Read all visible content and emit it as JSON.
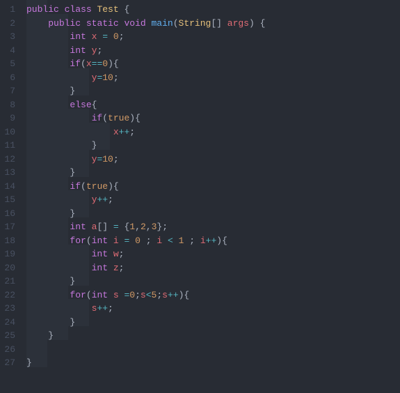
{
  "language": "java",
  "line_count": 27,
  "tokens": {
    "public": "public",
    "class": "class",
    "static": "static",
    "void": "void",
    "int": "int",
    "if": "if",
    "else": "else",
    "for": "for",
    "Test": "Test",
    "main": "main",
    "String": "String",
    "args": "args",
    "x": "x",
    "y": "y",
    "w": "w",
    "z": "z",
    "a": "a",
    "i": "i",
    "s": "s",
    "true": "true",
    "n0": "0",
    "n1": "1",
    "n2": "2",
    "n3": "3",
    "n5": "5",
    "n10": "10"
  },
  "lines": {
    "l1": "1",
    "l2": "2",
    "l3": "3",
    "l4": "4",
    "l5": "5",
    "l6": "6",
    "l7": "7",
    "l8": "8",
    "l9": "9",
    "l10": "10",
    "l11": "11",
    "l12": "12",
    "l13": "13",
    "l14": "14",
    "l15": "15",
    "l16": "16",
    "l17": "17",
    "l18": "18",
    "l19": "19",
    "l20": "20",
    "l21": "21",
    "l22": "22",
    "l23": "23",
    "l24": "24",
    "l25": "25",
    "l26": "26",
    "l27": "27"
  },
  "colors": {
    "background": "#282c34",
    "foreground": "#abb2bf",
    "keyword": "#c678dd",
    "class": "#e5c07b",
    "method": "#61afef",
    "variable": "#e06c75",
    "number": "#d19a66",
    "operator": "#56b6c2",
    "gutter": "#495162"
  }
}
